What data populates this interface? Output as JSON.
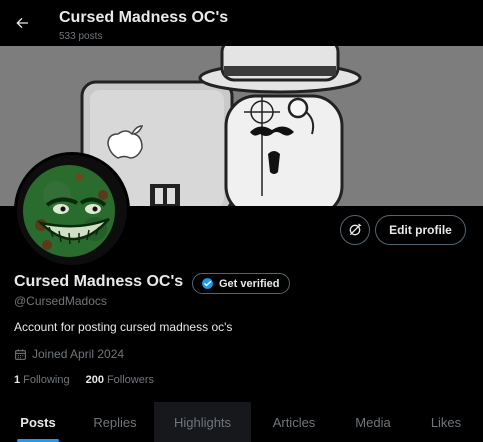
{
  "header": {
    "title": "Cursed Madness OC's",
    "post_count": "533 posts"
  },
  "icons": {
    "back": "arrow-left-icon",
    "relaxed_change": "refresh-cancel-icon",
    "verified": "verified-badge-icon",
    "calendar": "calendar-icon"
  },
  "profile": {
    "display_name": "Cursed Madness OC's",
    "verify_label": "Get verified",
    "handle": "@CursedMadocs",
    "bio": "Account for posting cursed madness oc's",
    "joined": "Joined April 2024",
    "following_count": "1",
    "following_label": "Following",
    "followers_count": "200",
    "followers_label": "Followers"
  },
  "actions": {
    "edit_profile": "Edit profile"
  },
  "tabs": [
    {
      "label": "Posts"
    },
    {
      "label": "Replies"
    },
    {
      "label": "Highlights"
    },
    {
      "label": "Articles"
    },
    {
      "label": "Media"
    },
    {
      "label": "Likes"
    }
  ],
  "colors": {
    "accent": "#1d9bf0",
    "background": "#000000",
    "text_primary": "#e7e9ea",
    "text_secondary": "#71767b",
    "border": "#536471"
  }
}
